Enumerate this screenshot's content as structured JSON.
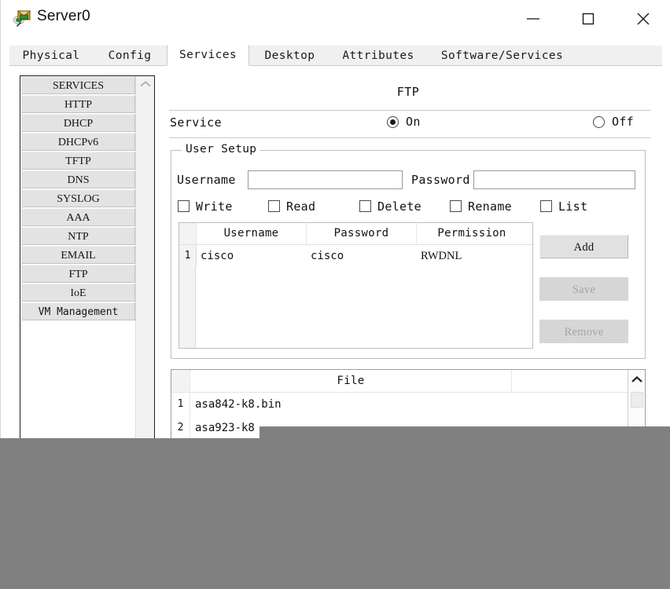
{
  "window": {
    "title": "Server0",
    "icon": "server-device-icon",
    "controls": {
      "minimize": "minimize-icon",
      "maximize": "maximize-icon",
      "close": "close-icon"
    }
  },
  "tabs": [
    {
      "label": "Physical",
      "active": false
    },
    {
      "label": "Config",
      "active": false
    },
    {
      "label": "Services",
      "active": true
    },
    {
      "label": "Desktop",
      "active": false
    },
    {
      "label": "Attributes",
      "active": false
    },
    {
      "label": "Software/Services",
      "active": false
    }
  ],
  "sidebar": {
    "scroll_up_icon": "chevron-up-icon",
    "items": [
      {
        "label": "SERVICES"
      },
      {
        "label": "HTTP"
      },
      {
        "label": "DHCP"
      },
      {
        "label": "DHCPv6"
      },
      {
        "label": "TFTP"
      },
      {
        "label": "DNS"
      },
      {
        "label": "SYSLOG"
      },
      {
        "label": "AAA"
      },
      {
        "label": "NTP"
      },
      {
        "label": "EMAIL"
      },
      {
        "label": "FTP"
      },
      {
        "label": "IoE"
      },
      {
        "label": "VM Management"
      }
    ]
  },
  "panel": {
    "title": "FTP",
    "service": {
      "label": "Service",
      "on_label": "On",
      "off_label": "Off",
      "selected": "On"
    },
    "user_setup": {
      "legend": "User Setup",
      "username_label": "Username",
      "username_value": "",
      "username_placeholder": "",
      "password_label": "Password",
      "password_value": "",
      "password_placeholder": "",
      "permissions": [
        {
          "label": "Write",
          "checked": false
        },
        {
          "label": "Read",
          "checked": false
        },
        {
          "label": "Delete",
          "checked": false
        },
        {
          "label": "Rename",
          "checked": false
        },
        {
          "label": "List",
          "checked": false
        }
      ],
      "table": {
        "headers": [
          "",
          "Username",
          "Password",
          "Permission"
        ],
        "rows": [
          {
            "num": "1",
            "username": "cisco",
            "password": "cisco",
            "permission": "RWDNL"
          }
        ]
      },
      "buttons": [
        {
          "label": "Add",
          "enabled": true
        },
        {
          "label": "Save",
          "enabled": false
        },
        {
          "label": "Remove",
          "enabled": false
        }
      ]
    },
    "file_list": {
      "header": "File",
      "scroll_up_icon": "chevron-up-icon",
      "rows": [
        {
          "num": "1",
          "name": "asa842-k8.bin"
        },
        {
          "num": "2",
          "name": "asa923-k8"
        }
      ]
    }
  },
  "colors": {
    "window_bg": "#ffffff",
    "tab_bg": "#f0f0f0",
    "button_face": "#e3e3e3",
    "disabled_text": "#a6a6a6",
    "occlusion": "#808080"
  }
}
